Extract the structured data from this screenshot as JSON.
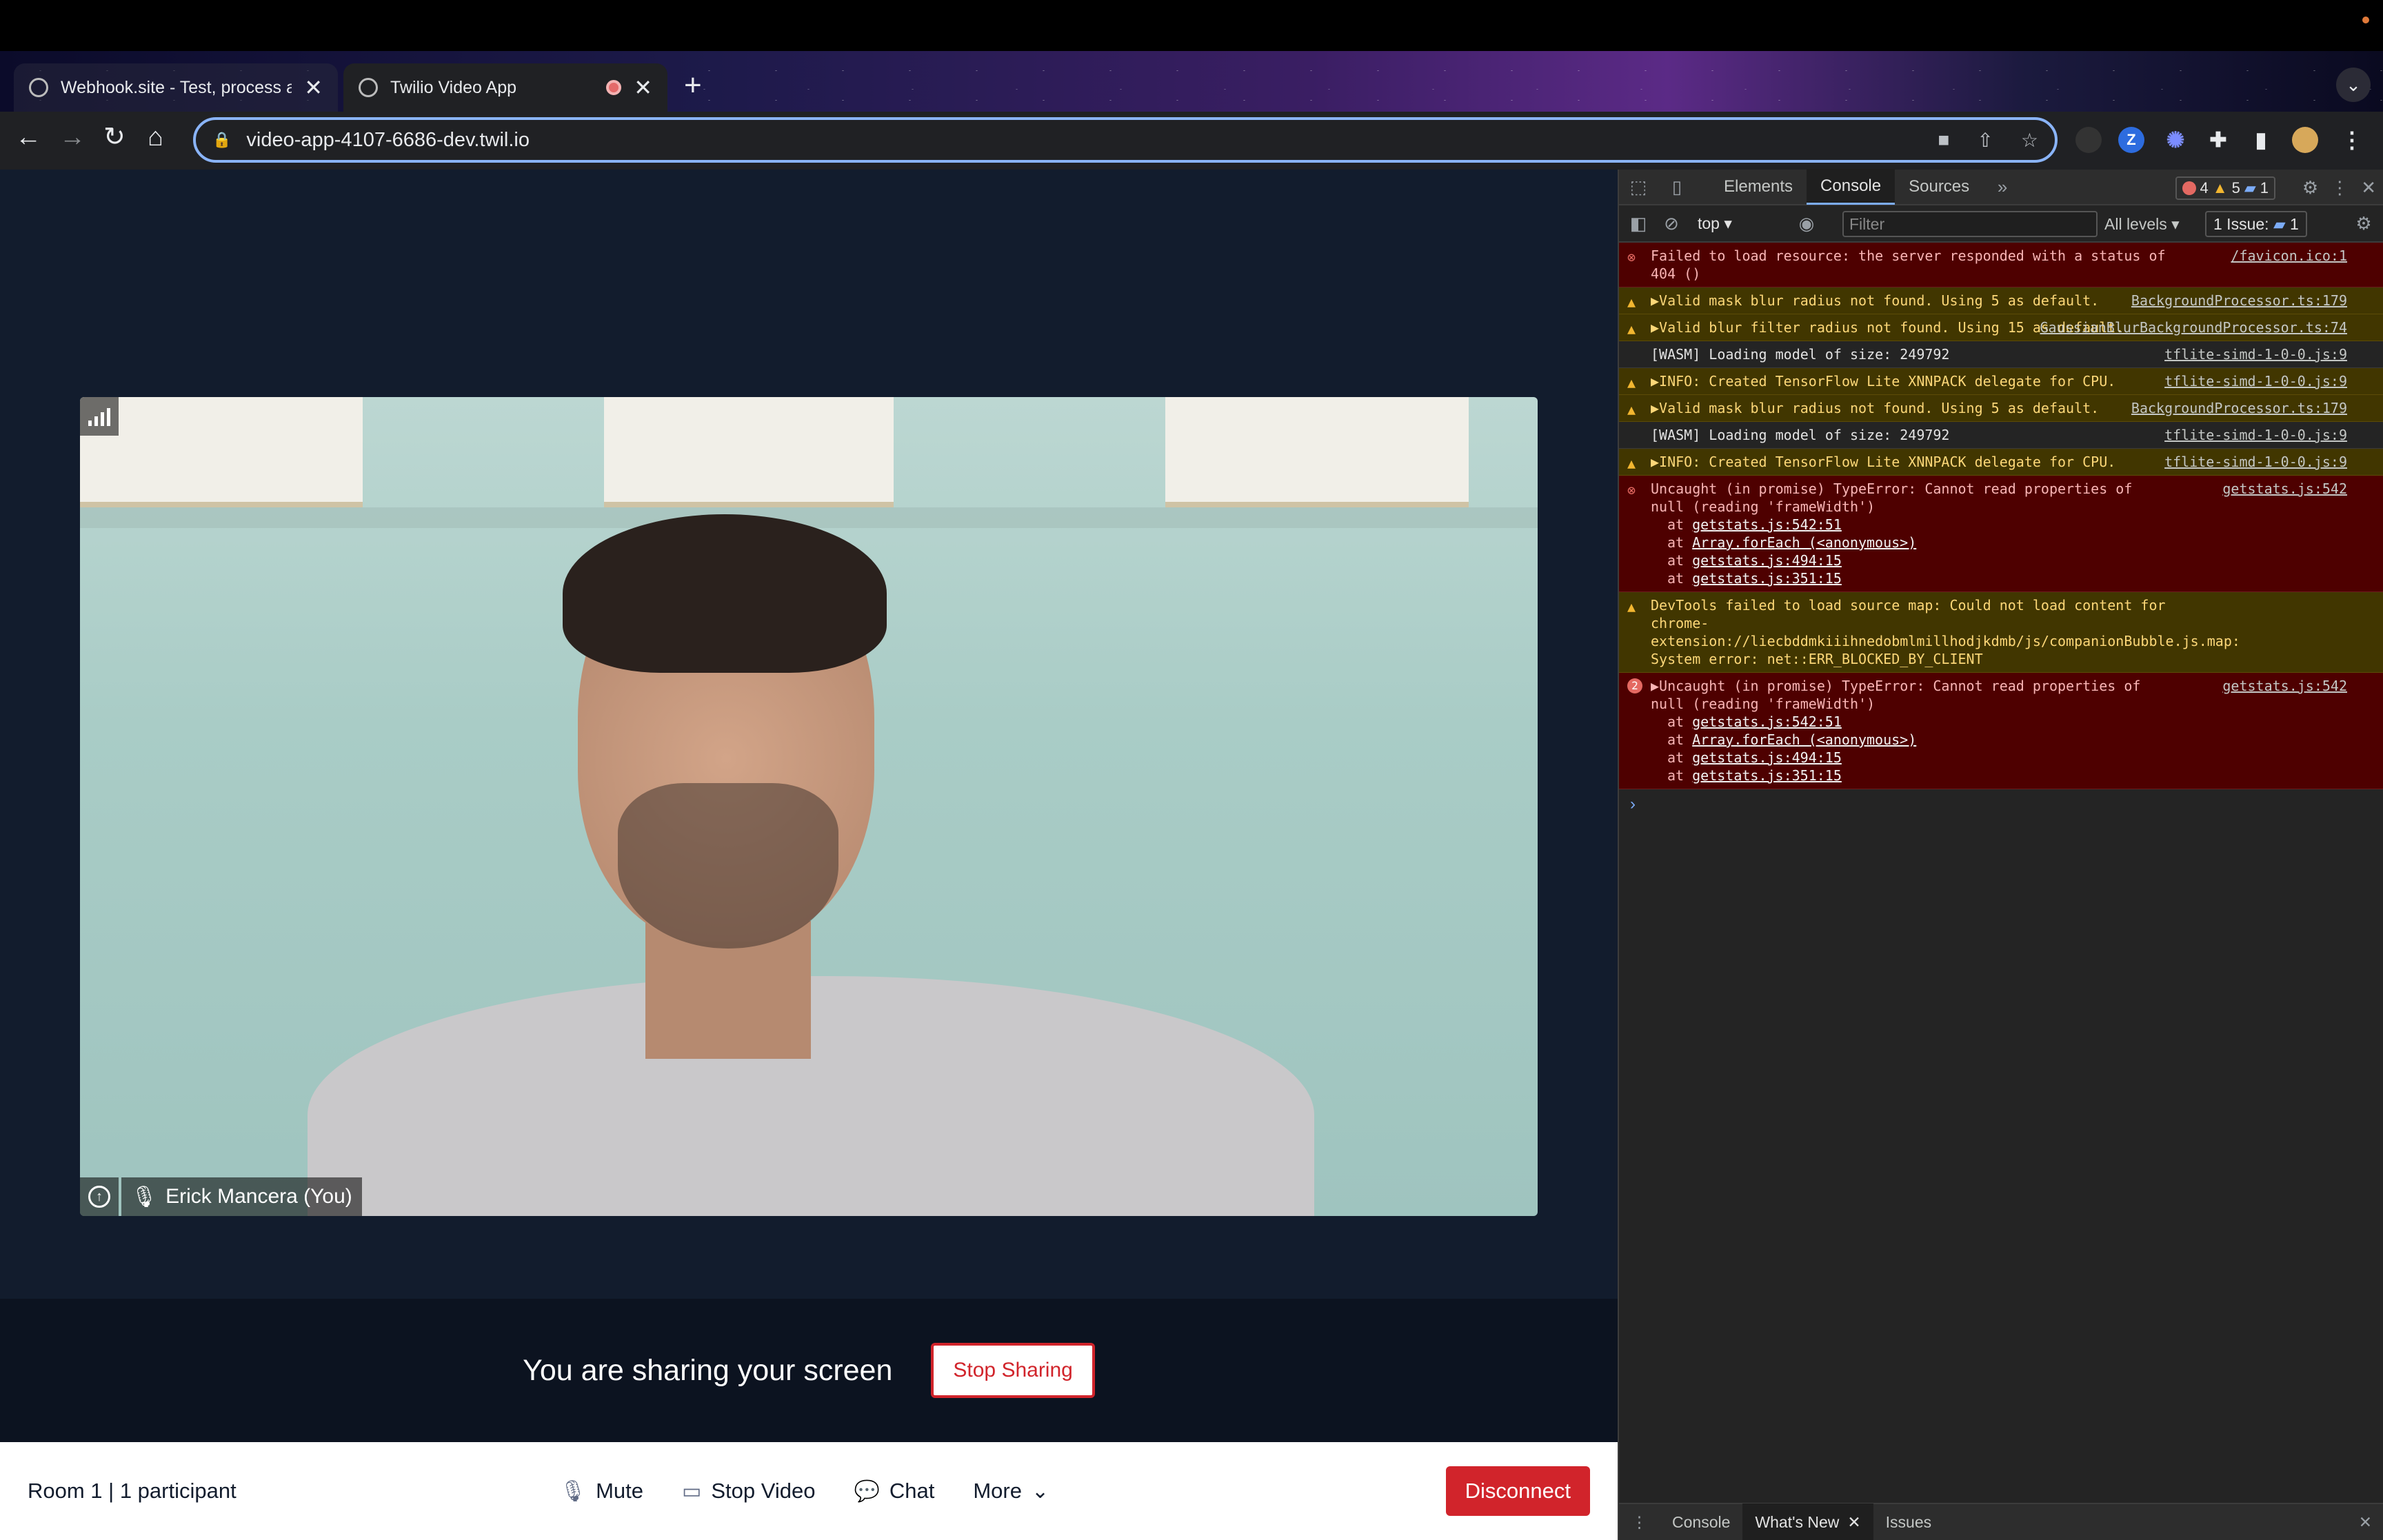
{
  "browser": {
    "tabs": [
      {
        "title": "Webhook.site - Test, process a",
        "close": "✕"
      },
      {
        "title": "Twilio Video App",
        "close": "✕"
      }
    ],
    "new_tab": "+",
    "url": "video-app-4107-6686-dev.twil.io",
    "ext_z": "Z"
  },
  "video": {
    "participant_name": "Erick Mancera (You)"
  },
  "share": {
    "text": "You are sharing your screen",
    "stop_label": "Stop Sharing"
  },
  "menu": {
    "room_info": "Room 1 | 1 participant",
    "mute": "Mute",
    "stop_video": "Stop Video",
    "chat": "Chat",
    "more": "More",
    "disconnect": "Disconnect"
  },
  "devtools": {
    "tabs": [
      "Elements",
      "Console",
      "Sources"
    ],
    "active_tab": "Console",
    "error_count": "4",
    "warn_count": "5",
    "info_count": "1",
    "context": "top",
    "filter_placeholder": "Filter",
    "levels": "All levels",
    "issues": "1 Issue:",
    "issues_count": "1",
    "drawer_tabs": [
      "Console",
      "What's New",
      "Issues"
    ],
    "logs": [
      {
        "level": "error",
        "msg": "Failed to load resource: the server responded with a status of 404 ()",
        "src": "/favicon.ico:1"
      },
      {
        "level": "warn",
        "msg": "▶Valid mask blur radius not found. Using 5 as default.",
        "src": "BackgroundProcessor.ts:179"
      },
      {
        "level": "warn",
        "msg": "▶Valid blur filter radius not found. Using 15 as default.",
        "src": "GaussianBlurBackgroundProcessor.ts:74"
      },
      {
        "level": "info",
        "msg": "[WASM] Loading model of size: 249792",
        "src": "tflite-simd-1-0-0.js:9"
      },
      {
        "level": "warn",
        "msg": "▶INFO: Created TensorFlow Lite XNNPACK delegate for CPU.",
        "src": "tflite-simd-1-0-0.js:9"
      },
      {
        "level": "warn",
        "msg": "▶Valid mask blur radius not found. Using 5 as default.",
        "src": "BackgroundProcessor.ts:179"
      },
      {
        "level": "info",
        "msg": "[WASM] Loading model of size: 249792",
        "src": "tflite-simd-1-0-0.js:9"
      },
      {
        "level": "warn",
        "msg": "▶INFO: Created TensorFlow Lite XNNPACK delegate for CPU.",
        "src": "tflite-simd-1-0-0.js:9"
      },
      {
        "level": "error",
        "msg": "Uncaught (in promise) TypeError: Cannot read properties of null (reading 'frameWidth')",
        "src": "getstats.js:542",
        "trace": [
          "getstats.js:542:51",
          "Array.forEach (<anonymous>)",
          "getstats.js:494:15",
          "getstats.js:351:15"
        ]
      },
      {
        "level": "warn",
        "msg": "DevTools failed to load source map: Could not load content for chrome-extension://liecbddmkiiihnedobmlmillhodjkdmb/js/companionBubble.js.map: System error: net::ERR_BLOCKED_BY_CLIENT",
        "src": ""
      },
      {
        "level": "error",
        "count": "2",
        "msg": "▶Uncaught (in promise) TypeError: Cannot read properties of null (reading 'frameWidth')",
        "src": "getstats.js:542",
        "trace": [
          "getstats.js:542:51",
          "Array.forEach (<anonymous>)",
          "getstats.js:494:15",
          "getstats.js:351:15"
        ]
      }
    ],
    "prompt": "›"
  }
}
